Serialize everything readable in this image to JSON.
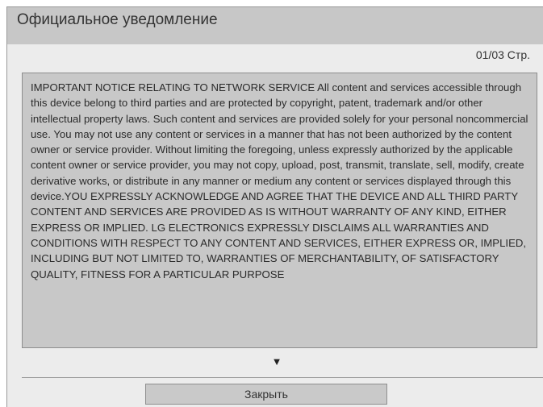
{
  "dialog": {
    "title": "Официальное уведомление",
    "page_indicator": "01/03 Стр.",
    "body_text": "IMPORTANT NOTICE RELATING TO NETWORK SERVICE All content and services accessible through this device belong to third parties and are protected by copyright, patent, trademark and/or other intellectual property laws. Such content and services are provided solely for your personal noncommercial use. You may not use any content or services in a manner that has not been authorized by the content owner or service provider. Without limiting the foregoing, unless expressly authorized by the applicable content owner or service provider, you may not copy, upload, post, transmit, translate, sell, modify, create derivative works, or distribute in any manner or medium any content or services displayed through this device.YOU EXPRESSLY ACKNOWLEDGE AND AGREE THAT THE DEVICE AND ALL THIRD PARTY CONTENT AND SERVICES ARE PROVIDED AS IS WITHOUT WARRANTY OF ANY KIND, EITHER EXPRESS OR IMPLIED. LG ELECTRONICS EXPRESSLY DISCLAIMS ALL WARRANTIES AND CONDITIONS WITH RESPECT TO ANY CONTENT AND SERVICES, EITHER EXPRESS OR, IMPLIED, INCLUDING BUT NOT LIMITED TO, WARRANTIES OF MERCHANTABILITY, OF SATISFACTORY QUALITY, FITNESS FOR A PARTICULAR PURPOSE",
    "scroll_arrow_icon": "triangle-down-icon",
    "close_label": "Закрыть"
  },
  "colors": {
    "title_bar": "#c7c7c7",
    "dialog_background": "#ececec",
    "text_panel": "#c8c8c8",
    "button": "#c9c9c9",
    "text": "#333333"
  }
}
